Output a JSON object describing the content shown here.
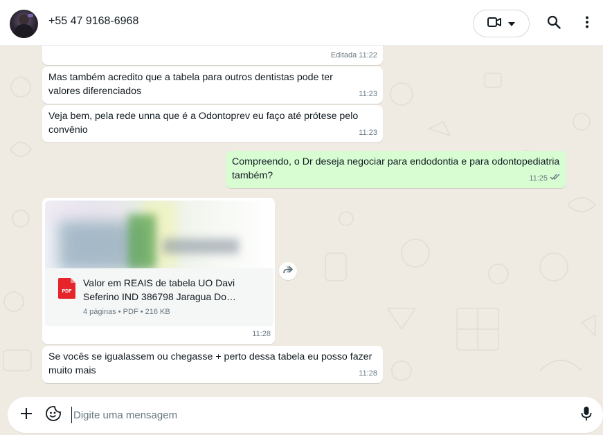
{
  "header": {
    "contact_name": "+55 47 9168-6968",
    "icons": [
      "avatar",
      "video-call-icon",
      "chevron-down-icon",
      "search-icon",
      "more-vert-icon"
    ]
  },
  "messages": [
    {
      "direction": "in",
      "text": "",
      "time": "Editada 11:22"
    },
    {
      "direction": "in",
      "text": "Mas também acredito que a tabela para outros dentistas pode ter valores diferenciados",
      "time": "11:23"
    },
    {
      "direction": "in",
      "text": "Veja bem, pela rede unna que é a Odontoprev eu faço até prótese pelo convênio",
      "time": "11:23"
    },
    {
      "direction": "out",
      "text": "Compreendo, o Dr deseja negociar para endodontia e para odontopediatria também?",
      "time": "11:25",
      "status": "read"
    },
    {
      "direction": "in",
      "type": "document",
      "doc_name": "Valor em REAIS de tabela UO Davi Seferino IND 386798 Jaragua Do…",
      "doc_info": "4 páginas • PDF • 216 KB",
      "time": "11:28"
    },
    {
      "direction": "in",
      "text": "Se vocês se igualassem ou chegasse + perto dessa tabela eu posso fazer muito mais",
      "time": "11:28"
    }
  ],
  "composer": {
    "placeholder": "Digite uma mensagem",
    "value": ""
  },
  "colors": {
    "chat_bg": "#efeae2",
    "incoming_bubble": "#ffffff",
    "outgoing_bubble": "#d9fdd3",
    "pdf_red": "#e5252a",
    "read_tick": "#667781"
  }
}
